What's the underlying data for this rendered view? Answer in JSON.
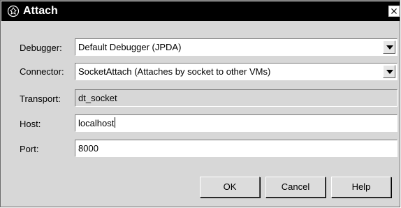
{
  "window": {
    "title": "Attach",
    "icons": {
      "app": "debugger-bug-icon",
      "close": "close-icon"
    }
  },
  "form": {
    "debugger": {
      "label": "Debugger:",
      "value": "Default Debugger (JPDA)"
    },
    "connector": {
      "label": "Connector:",
      "value": "SocketAttach (Attaches by socket to other VMs)"
    },
    "transport": {
      "label": "Transport:",
      "value": "dt_socket"
    },
    "host": {
      "label": "Host:",
      "value": "localhost"
    },
    "port": {
      "label": "Port:",
      "value": "8000"
    }
  },
  "buttons": {
    "ok": "OK",
    "cancel": "Cancel",
    "help": "Help"
  }
}
